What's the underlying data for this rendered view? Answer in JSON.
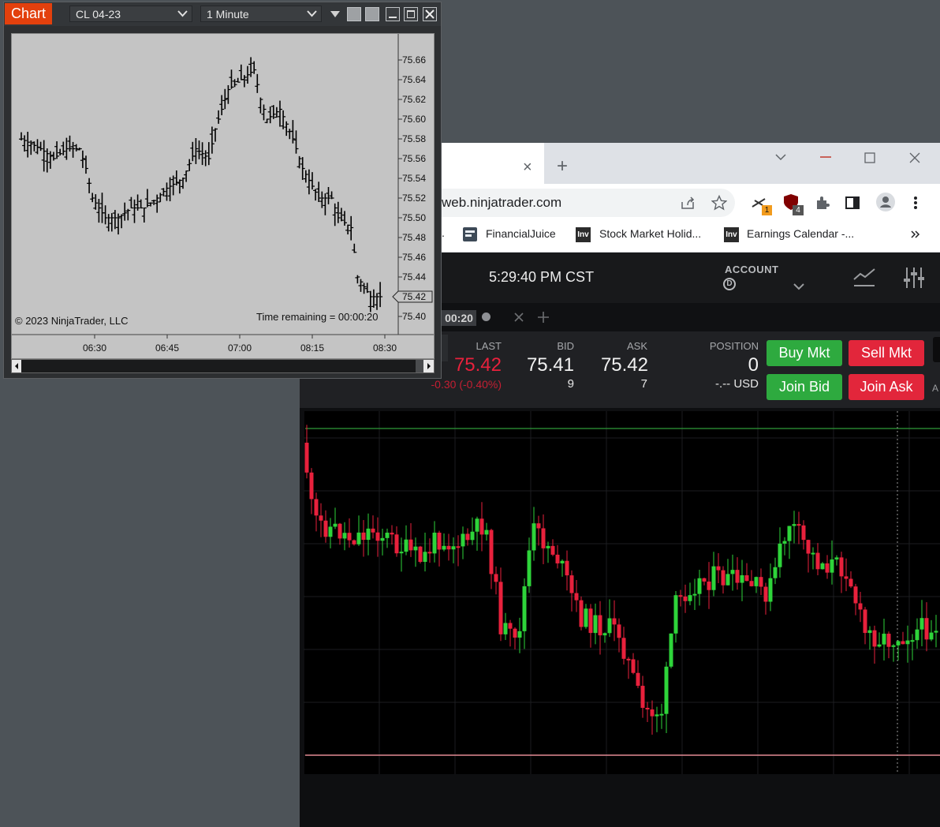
{
  "nt_chart": {
    "title_button": "Chart",
    "instrument": "CL 04-23",
    "interval": "1 Minute",
    "copyright": "© 2023 NinjaTrader, LLC",
    "time_remaining": "Time remaining = 00:00:20",
    "price_ticks": [
      "75.66",
      "75.64",
      "75.62",
      "75.60",
      "75.58",
      "75.56",
      "75.54",
      "75.52",
      "75.50",
      "75.48",
      "75.46",
      "75.44",
      "75.42",
      "75.40"
    ],
    "current_price": "75.42",
    "time_ticks": [
      "06:30",
      "06:45",
      "07:00",
      "08:15",
      "08:30"
    ]
  },
  "browser": {
    "url": "web.ninjatrader.com",
    "bookmarks": [
      "FinancialJuice",
      "Stock Market Holid...",
      "Earnings Calendar -..."
    ],
    "bookmark_icon_text": "Inv",
    "ext_badges": [
      "1",
      "4"
    ],
    "tab_close": "×",
    "new_tab": "+"
  },
  "web_trader": {
    "clock": "5:29:40 PM CST",
    "account_label": "ACCOUNT",
    "account_badge": "D",
    "tab_timer": "00:20",
    "quote": {
      "last_label": "LAST",
      "last": "75.42",
      "change": "-0.30 (-0.40%)",
      "bid_label": "BID",
      "bid": "75.41",
      "bid_size": "9",
      "ask_label": "ASK",
      "ask": "75.42",
      "ask_size": "7",
      "position_label": "POSITION",
      "position": "0",
      "pnl": "-.-- USD"
    },
    "buttons": {
      "buy_mkt": "Buy Mkt",
      "sell_mkt": "Sell Mkt",
      "join_bid": "Join Bid",
      "join_ask": "Join Ask"
    },
    "edge_label": "A"
  },
  "colors": {
    "up": "#2ed43a",
    "down": "#e8213c",
    "nt_orange": "#e3400d"
  }
}
